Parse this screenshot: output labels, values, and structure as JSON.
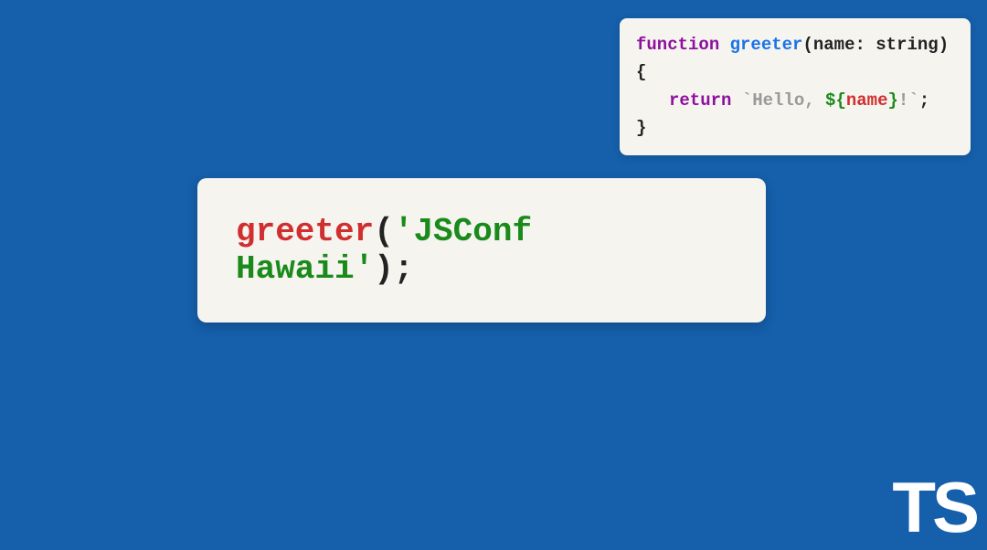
{
  "topSnippet": {
    "line1": {
      "keyword": "function",
      "space1": " ",
      "funcname": "greeter",
      "openParen": "(",
      "param": "name",
      "colon": ": ",
      "type": "string",
      "closeParen": ")",
      "space2": " ",
      "openBrace": "{"
    },
    "line2": {
      "keyword": "return",
      "space1": " ",
      "strOpen": "`Hello, ",
      "interpOpen": "${",
      "interpVar": "name",
      "interpClose": "}",
      "strClose": "!`",
      "semicolon": ";"
    },
    "line3": {
      "closeBrace": "}"
    }
  },
  "mainSnippet": {
    "call": "greeter",
    "openParen": "(",
    "arg": "'JSConf Hawaii'",
    "closeParen": ")",
    "semicolon": ";"
  },
  "logo": "TS"
}
